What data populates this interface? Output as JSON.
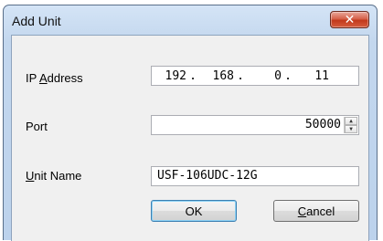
{
  "window": {
    "title": "Add Unit",
    "close_glyph": "✕"
  },
  "form": {
    "ip_address": {
      "label_mnemonic": "IP A",
      "label_key": "A",
      "label_rest": "ddress",
      "octets": [
        "192",
        "168",
        "0",
        "11"
      ],
      "separator": "."
    },
    "port": {
      "label": "Port",
      "value": "50000",
      "spin_up_glyph": "▲",
      "spin_down_glyph": "▼"
    },
    "unit_name": {
      "label_key": "U",
      "label_rest": "nit Name",
      "value": "USF-106UDC-12G"
    }
  },
  "buttons": {
    "ok_label": "OK",
    "cancel_key": "C",
    "cancel_rest": "ancel"
  },
  "colors": {
    "close_button": "#c2391c",
    "title_bar": "#bcd2ec",
    "client_bg": "#f0f0f0"
  }
}
